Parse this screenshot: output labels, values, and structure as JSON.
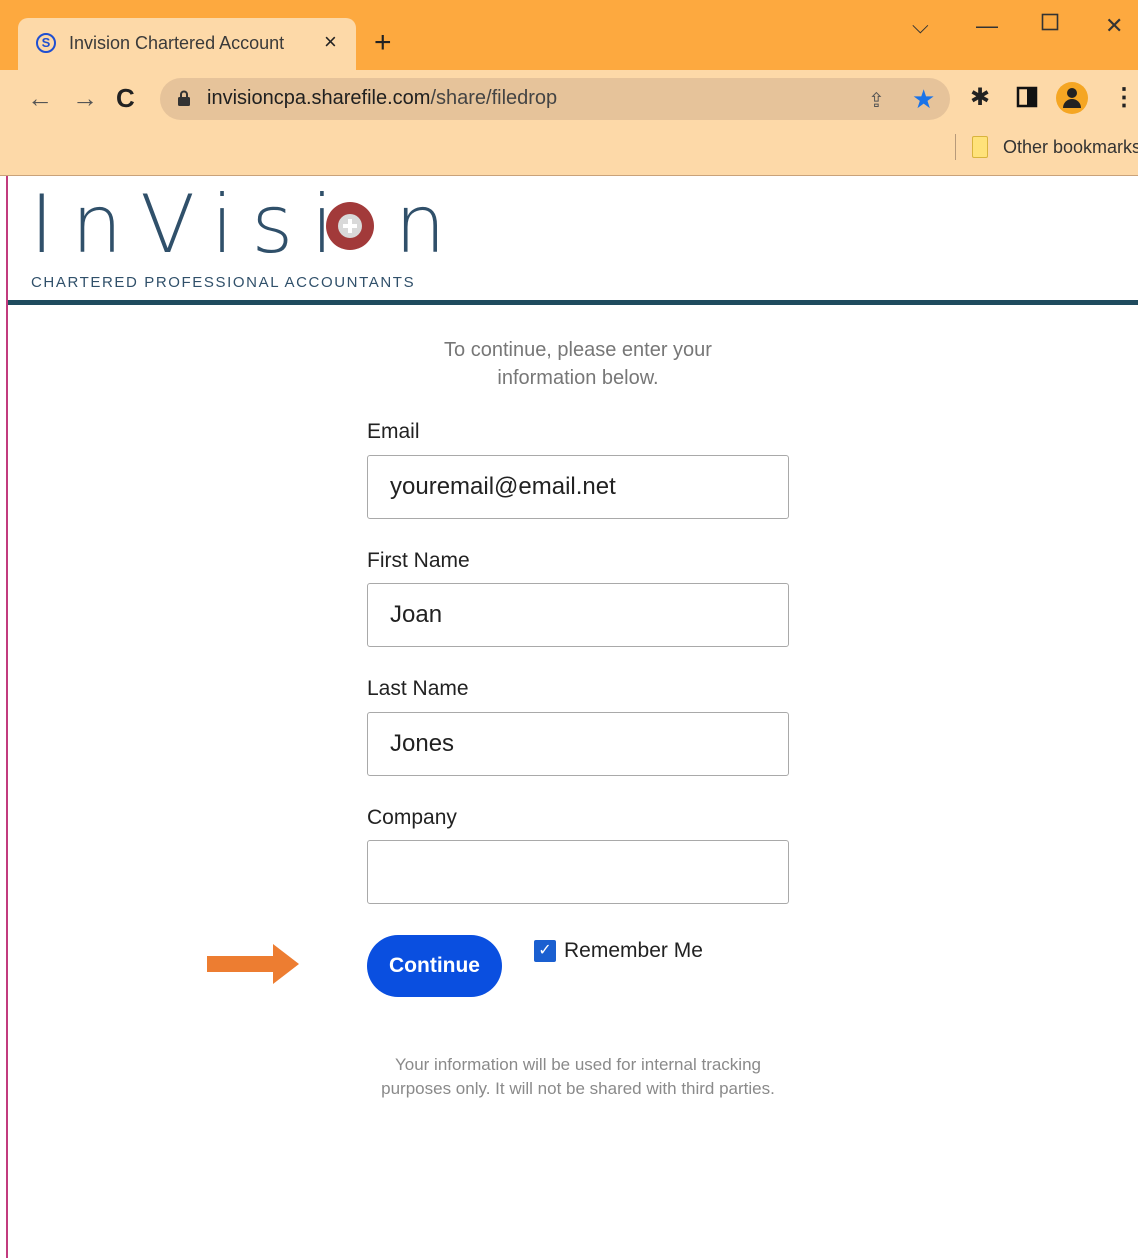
{
  "browser": {
    "tab_title": "Invision Chartered Account",
    "tab_close": "×",
    "new_tab": "+",
    "url_host": "invisioncpa.sharefile.com",
    "url_path": "/share/filedrop",
    "bookmarks_label": "Other bookmarks",
    "icons": [
      "sharefile-favicon",
      "close-icon",
      "plus-icon",
      "chevron-down-icon",
      "minimize-icon",
      "maximize-icon",
      "close-window-icon",
      "back-icon",
      "forward-icon",
      "reload-icon",
      "lock-icon",
      "share-icon",
      "star-icon",
      "extensions-icon",
      "side-panel-icon",
      "profile-icon",
      "menu-icon",
      "folder-icon"
    ],
    "colors": {
      "tabstrip": "#fda93f",
      "toolbar": "#fdd9a8",
      "star": "#1a73e8"
    }
  },
  "brand": {
    "letters": "InVisi n",
    "subtitle": "CHARTERED PROFESSIONAL ACCOUNTANTS",
    "colors": {
      "text": "#30506a",
      "rule": "#1f4b5e",
      "o_mark": "#a23a3a"
    }
  },
  "form": {
    "intro": "To continue, please enter your information below.",
    "email_label": "Email",
    "email_value": "youremail@email.net",
    "first_name_label": "First Name",
    "first_name_value": "Joan",
    "last_name_label": "Last Name",
    "last_name_value": "Jones",
    "company_label": "Company",
    "company_value": "",
    "continue_label": "Continue",
    "remember_label": "Remember Me",
    "remember_checked": true,
    "disclaimer": "Your information will be used for internal tracking purposes only. It will not be shared with third parties.",
    "colors": {
      "button": "#0a4fe0",
      "checkbox": "#1a5fd0",
      "annotation_arrow": "#ed7d31"
    }
  }
}
